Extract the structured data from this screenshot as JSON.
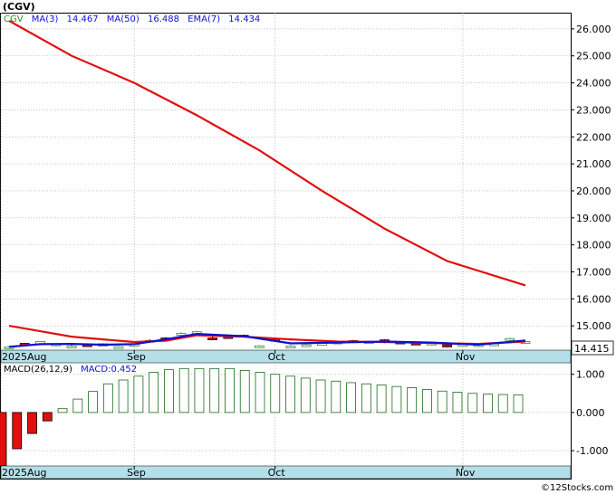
{
  "ticker_title": "(CGV)",
  "legend": {
    "symbol": "CGV",
    "ma3": "MA(3)",
    "ma3_val": "14.467",
    "ma50": "MA(50)",
    "ma50_val": "16.488",
    "ema7": "EMA(7)",
    "ema7_val": "14.434"
  },
  "last_price_label": "14.415",
  "macd_legend": {
    "label": "MACD(26,12,9)",
    "value": "MACD:0.452"
  },
  "watermark": "©12Stocks.com",
  "x_labels": [
    "2025Aug",
    "Sep",
    "Oct",
    "Nov"
  ],
  "colors": {
    "up": "#2e8b2e",
    "down": "#e01010",
    "ma3": "#1010d0",
    "ma50": "#e01010",
    "ema7": "#e01010",
    "grid": "#a0a0a0",
    "axis_band": "#b4dfe8",
    "macd_bar": "#1a6b1a"
  },
  "chart_data": [
    {
      "type": "candlestick",
      "title": "(CGV)",
      "ylim": [
        14.1,
        26.6
      ],
      "y_ticks": [
        15.0,
        16.0,
        17.0,
        18.0,
        19.0,
        20.0,
        21.0,
        22.0,
        23.0,
        24.0,
        25.0,
        26.0
      ],
      "x_tick_labels": [
        "2025Aug",
        "Sep",
        "Oct",
        "Nov"
      ],
      "grid": true,
      "candles": [
        {
          "o": 14.2,
          "h": 14.25,
          "l": 14.18,
          "c": 14.22
        },
        {
          "o": 14.35,
          "h": 14.36,
          "l": 14.28,
          "c": 14.3
        },
        {
          "o": 14.3,
          "h": 14.42,
          "l": 14.28,
          "c": 14.42
        },
        {
          "o": 14.33,
          "h": 14.35,
          "l": 14.3,
          "c": 14.33
        },
        {
          "o": 14.2,
          "h": 14.3,
          "l": 14.2,
          "c": 14.25
        },
        {
          "o": 14.3,
          "h": 14.32,
          "l": 14.28,
          "c": 14.29
        },
        {
          "o": 14.33,
          "h": 14.35,
          "l": 14.3,
          "c": 14.32
        },
        {
          "o": 14.22,
          "h": 14.25,
          "l": 14.2,
          "c": 14.23
        },
        {
          "o": 14.3,
          "h": 14.32,
          "l": 14.28,
          "c": 14.31
        },
        {
          "o": 14.45,
          "h": 14.5,
          "l": 14.4,
          "c": 14.46
        },
        {
          "o": 14.55,
          "h": 14.58,
          "l": 14.52,
          "c": 14.54
        },
        {
          "o": 14.7,
          "h": 14.75,
          "l": 14.65,
          "c": 14.72
        },
        {
          "o": 14.75,
          "h": 14.8,
          "l": 14.7,
          "c": 14.78
        },
        {
          "o": 14.55,
          "h": 14.6,
          "l": 14.48,
          "c": 14.5
        },
        {
          "o": 14.6,
          "h": 14.62,
          "l": 14.55,
          "c": 14.58
        },
        {
          "o": 14.65,
          "h": 14.68,
          "l": 14.6,
          "c": 14.64
        },
        {
          "o": 14.2,
          "h": 14.28,
          "l": 14.18,
          "c": 14.26
        },
        {
          "o": 14.5,
          "h": 14.52,
          "l": 14.45,
          "c": 14.48
        },
        {
          "o": 14.25,
          "h": 14.28,
          "l": 14.22,
          "c": 14.25
        },
        {
          "o": 14.28,
          "h": 14.32,
          "l": 14.25,
          "c": 14.3
        },
        {
          "o": 14.35,
          "h": 14.38,
          "l": 14.32,
          "c": 14.35
        },
        {
          "o": 14.4,
          "h": 14.42,
          "l": 14.36,
          "c": 14.4
        },
        {
          "o": 14.45,
          "h": 14.48,
          "l": 14.4,
          "c": 14.44
        },
        {
          "o": 14.4,
          "h": 14.44,
          "l": 14.38,
          "c": 14.42
        },
        {
          "o": 14.48,
          "h": 14.5,
          "l": 14.36,
          "c": 14.38
        },
        {
          "o": 14.4,
          "h": 14.42,
          "l": 14.36,
          "c": 14.38
        },
        {
          "o": 14.36,
          "h": 14.38,
          "l": 14.33,
          "c": 14.35
        },
        {
          "o": 14.36,
          "h": 14.38,
          "l": 14.34,
          "c": 14.36
        },
        {
          "o": 14.3,
          "h": 14.32,
          "l": 14.2,
          "c": 14.22
        },
        {
          "o": 14.3,
          "h": 14.33,
          "l": 14.28,
          "c": 14.31
        },
        {
          "o": 14.28,
          "h": 14.32,
          "l": 14.26,
          "c": 14.3
        },
        {
          "o": 14.3,
          "h": 14.35,
          "l": 14.28,
          "c": 14.33
        },
        {
          "o": 14.5,
          "h": 14.55,
          "l": 14.46,
          "c": 14.53
        },
        {
          "o": 14.4,
          "h": 14.42,
          "l": 14.38,
          "c": 14.42
        }
      ],
      "series": [
        {
          "name": "MA(50)",
          "values": [
            {
              "i": 0,
              "v": 26.3
            },
            {
              "i": 4,
              "v": 25.0
            },
            {
              "i": 8,
              "v": 24.0
            },
            {
              "i": 12,
              "v": 22.8
            },
            {
              "i": 16,
              "v": 21.5
            },
            {
              "i": 20,
              "v": 20.0
            },
            {
              "i": 24,
              "v": 18.6
            },
            {
              "i": 28,
              "v": 17.4
            },
            {
              "i": 33,
              "v": 16.5
            }
          ]
        },
        {
          "name": "EMA(7)",
          "values": [
            {
              "i": 0,
              "v": 15.0
            },
            {
              "i": 2,
              "v": 14.8
            },
            {
              "i": 4,
              "v": 14.6
            },
            {
              "i": 6,
              "v": 14.5
            },
            {
              "i": 8,
              "v": 14.4
            },
            {
              "i": 10,
              "v": 14.45
            },
            {
              "i": 12,
              "v": 14.65
            },
            {
              "i": 15,
              "v": 14.6
            },
            {
              "i": 18,
              "v": 14.5
            },
            {
              "i": 21,
              "v": 14.42
            },
            {
              "i": 24,
              "v": 14.4
            },
            {
              "i": 27,
              "v": 14.36
            },
            {
              "i": 30,
              "v": 14.33
            },
            {
              "i": 33,
              "v": 14.42
            }
          ]
        },
        {
          "name": "MA(3)",
          "values": [
            {
              "i": 0,
              "v": 14.22
            },
            {
              "i": 2,
              "v": 14.32
            },
            {
              "i": 4,
              "v": 14.33
            },
            {
              "i": 6,
              "v": 14.3
            },
            {
              "i": 8,
              "v": 14.32
            },
            {
              "i": 10,
              "v": 14.5
            },
            {
              "i": 12,
              "v": 14.7
            },
            {
              "i": 15,
              "v": 14.62
            },
            {
              "i": 18,
              "v": 14.35
            },
            {
              "i": 21,
              "v": 14.38
            },
            {
              "i": 24,
              "v": 14.42
            },
            {
              "i": 27,
              "v": 14.38
            },
            {
              "i": 30,
              "v": 14.3
            },
            {
              "i": 33,
              "v": 14.46
            }
          ]
        }
      ]
    },
    {
      "type": "bar",
      "title": "MACD(26,12,9)",
      "ylim": [
        -1.4,
        1.3
      ],
      "y_ticks": [
        1.0,
        0.0,
        -1.0
      ],
      "y_tick_labels": [
        "1.000",
        "0.000",
        "-1.000"
      ],
      "grid": true,
      "values": [
        -1.4,
        -0.95,
        -0.55,
        -0.22,
        0.1,
        0.35,
        0.55,
        0.75,
        0.85,
        0.95,
        1.05,
        1.12,
        1.15,
        1.15,
        1.15,
        1.15,
        1.1,
        1.05,
        1.0,
        0.95,
        0.9,
        0.85,
        0.82,
        0.78,
        0.75,
        0.72,
        0.68,
        0.65,
        0.6,
        0.56,
        0.53,
        0.5,
        0.48,
        0.47,
        0.46
      ]
    }
  ]
}
